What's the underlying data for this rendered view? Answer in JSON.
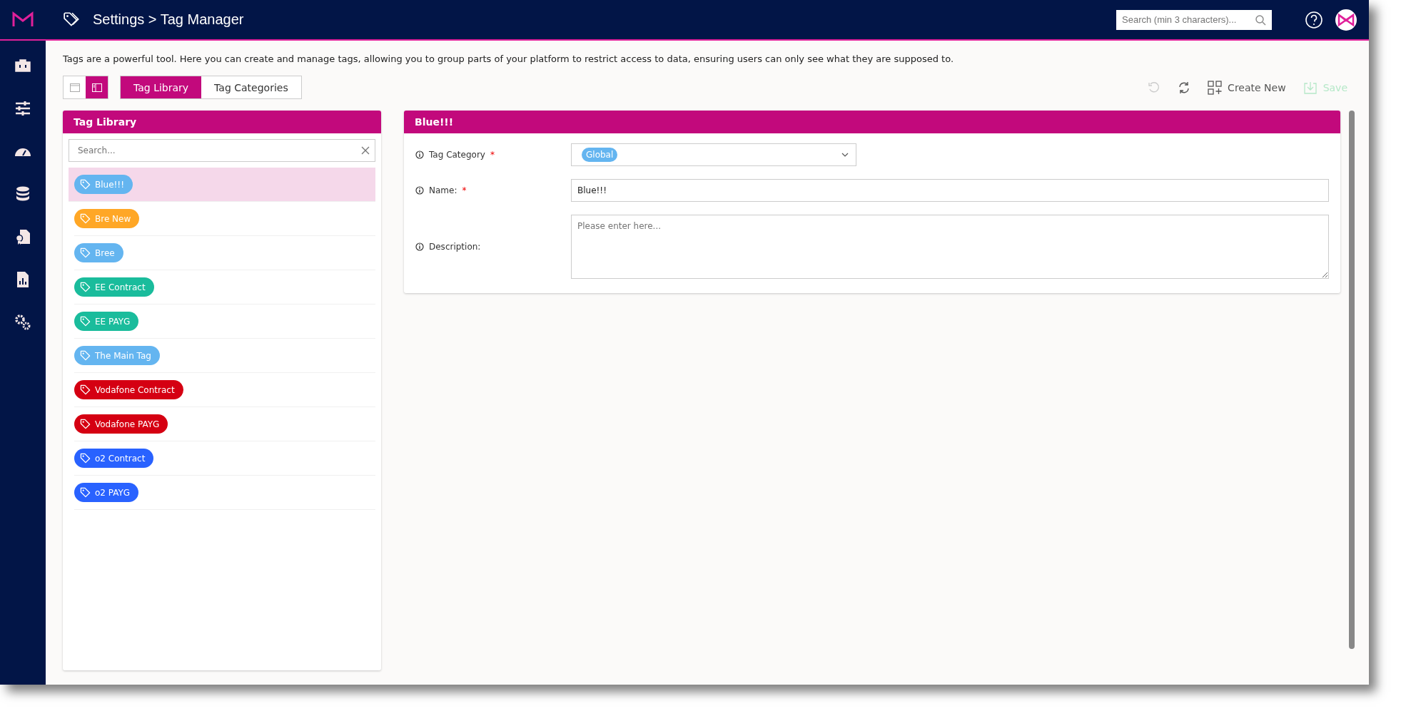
{
  "header": {
    "title": "Settings > Tag Manager",
    "search": {
      "placeholder": "Search (min 3 characters)..."
    }
  },
  "intro": "Tags are a powerful tool. Here you can create and manage tags, allowing you to group parts of your platform to restrict access to data, ensuring users can only see what they are supposed to.",
  "view_toggle": [
    {
      "kind": "single",
      "selected": false
    },
    {
      "kind": "split",
      "selected": true
    }
  ],
  "tabs": [
    {
      "label": "Tag Library",
      "selected": true
    },
    {
      "label": "Tag Categories",
      "selected": false
    }
  ],
  "actions": [
    {
      "kind": "undo",
      "disabled": true
    },
    {
      "kind": "refresh",
      "disabled": false
    },
    {
      "kind": "create",
      "label": "Create New",
      "disabled": false
    },
    {
      "kind": "save",
      "label": "Save",
      "disabled": true
    }
  ],
  "library": {
    "title": "Tag Library",
    "search": {
      "placeholder": "Search..."
    },
    "tags": [
      {
        "name": "Blue!!!",
        "color": "#64b5f0",
        "selected": true
      },
      {
        "name": "Bre New",
        "color": "#ffa726",
        "selected": false
      },
      {
        "name": "Bree",
        "color": "#64b5f0",
        "selected": false
      },
      {
        "name": "EE Contract",
        "color": "#1abc9c",
        "selected": false
      },
      {
        "name": "EE PAYG",
        "color": "#1abc9c",
        "selected": false
      },
      {
        "name": "The Main Tag",
        "color": "#64b5f0",
        "selected": false
      },
      {
        "name": "Vodafone Contract",
        "color": "#d50012",
        "selected": false
      },
      {
        "name": "Vodafone PAYG",
        "color": "#d50012",
        "selected": false
      },
      {
        "name": "o2 Contract",
        "color": "#2962ff",
        "selected": false
      },
      {
        "name": "o2 PAYG",
        "color": "#2962ff",
        "selected": false
      }
    ]
  },
  "detail": {
    "title": "Blue!!!",
    "fields": [
      {
        "kind": "select",
        "label": "Tag Category",
        "required_mark": "*",
        "chip": {
          "label": "Global",
          "color": "#64b5f0"
        }
      },
      {
        "kind": "text",
        "label": "Name:",
        "required_mark": "*",
        "value": "Blue!!!"
      },
      {
        "kind": "textarea",
        "label": "Description:",
        "placeholder": "Please enter here..."
      }
    ]
  }
}
